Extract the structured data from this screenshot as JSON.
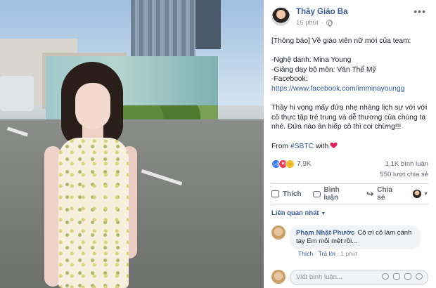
{
  "post": {
    "author": "Thầy Giáo Ba",
    "time": "16 phút",
    "body": {
      "notice": "[Thông báo] Về giáo viên nữ mới của team:",
      "line_name": "-Nghệ danh: Mina Young",
      "line_subject": "-Giảng dạy bộ môn: Văn Thể Mỹ",
      "line_fb_label": "-Facebook: ",
      "line_fb_url": "https://www.facebook.com/imminayoungg",
      "paragraph": "Thầy hi vọng mấy đứa nhẹ nhàng lịch sự với với cô thực tập trẻ trung và dễ thương của chúng ta nhé. Đứa nào ăn hiếp cô thì coi chừng!!!",
      "from_prefix": "From ",
      "hashtag": "#SBTC",
      "from_suffix": " with "
    },
    "reactions": {
      "count": "7,9K",
      "types": [
        "like-icon",
        "love-icon",
        "haha-icon"
      ]
    },
    "stats": {
      "comments": "1,1K bình luận",
      "shares": "550 lượt chia sẻ"
    },
    "actions": {
      "like": "Thích",
      "comment": "Bình luận",
      "share": "Chia sẻ"
    },
    "sort_label": "Liên quan nhất",
    "comment": {
      "name": "Phạm Nhật Phước",
      "text": "Cô ơi cô làm cánh tay Em mỏi mệt rồi...",
      "like": "Thích",
      "reply": "Trả lời",
      "time": "1 phút"
    },
    "composer": {
      "placeholder": "Viết bình luận..."
    }
  },
  "colors": {
    "link": "#385898",
    "heart": "#e0245e",
    "like": "#3b7ef0"
  }
}
